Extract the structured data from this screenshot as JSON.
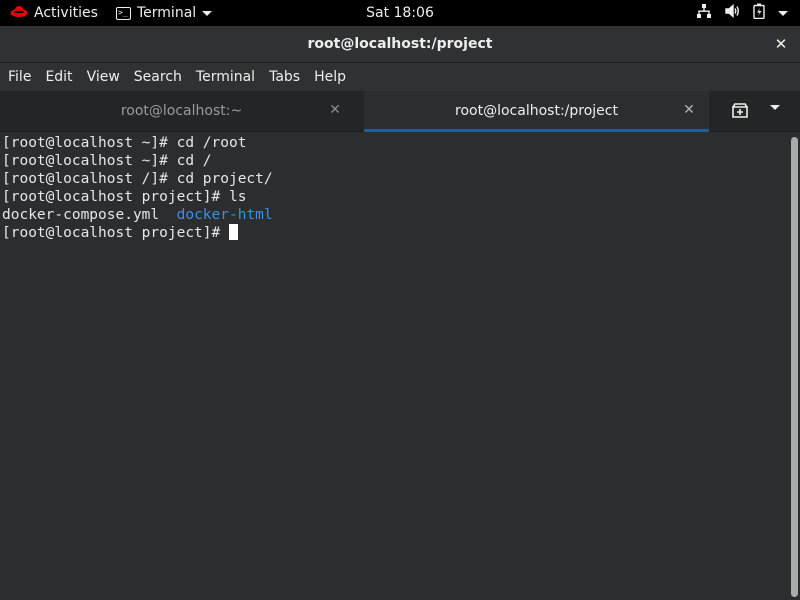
{
  "topbar": {
    "activities_label": "Activities",
    "app_label": "Terminal",
    "clock": "Sat 18:06",
    "icons": [
      "network-icon",
      "volume-icon",
      "battery-icon",
      "power-menu-icon"
    ]
  },
  "window": {
    "title": "root@localhost:/project"
  },
  "menu": {
    "items": [
      "File",
      "Edit",
      "View",
      "Search",
      "Terminal",
      "Tabs",
      "Help"
    ]
  },
  "tabs": [
    {
      "label": "root@localhost:~",
      "active": false
    },
    {
      "label": "root@localhost:/project",
      "active": true
    }
  ],
  "terminal": {
    "lines": [
      "[root@localhost ~]# cd /root",
      "[root@localhost ~]# cd /",
      "[root@localhost /]# cd project/",
      "[root@localhost project]# ls"
    ],
    "ls_output": {
      "file": "docker-compose.yml",
      "dir": "docker-html"
    },
    "prompt": "[root@localhost project]# "
  },
  "colors": {
    "topbar_bg": "#000000",
    "terminal_bg": "#2b2d2f",
    "accent_tab_underline": "#215d9c",
    "directory_color": "#3b8eea",
    "redhat_red": "#ee0000"
  }
}
